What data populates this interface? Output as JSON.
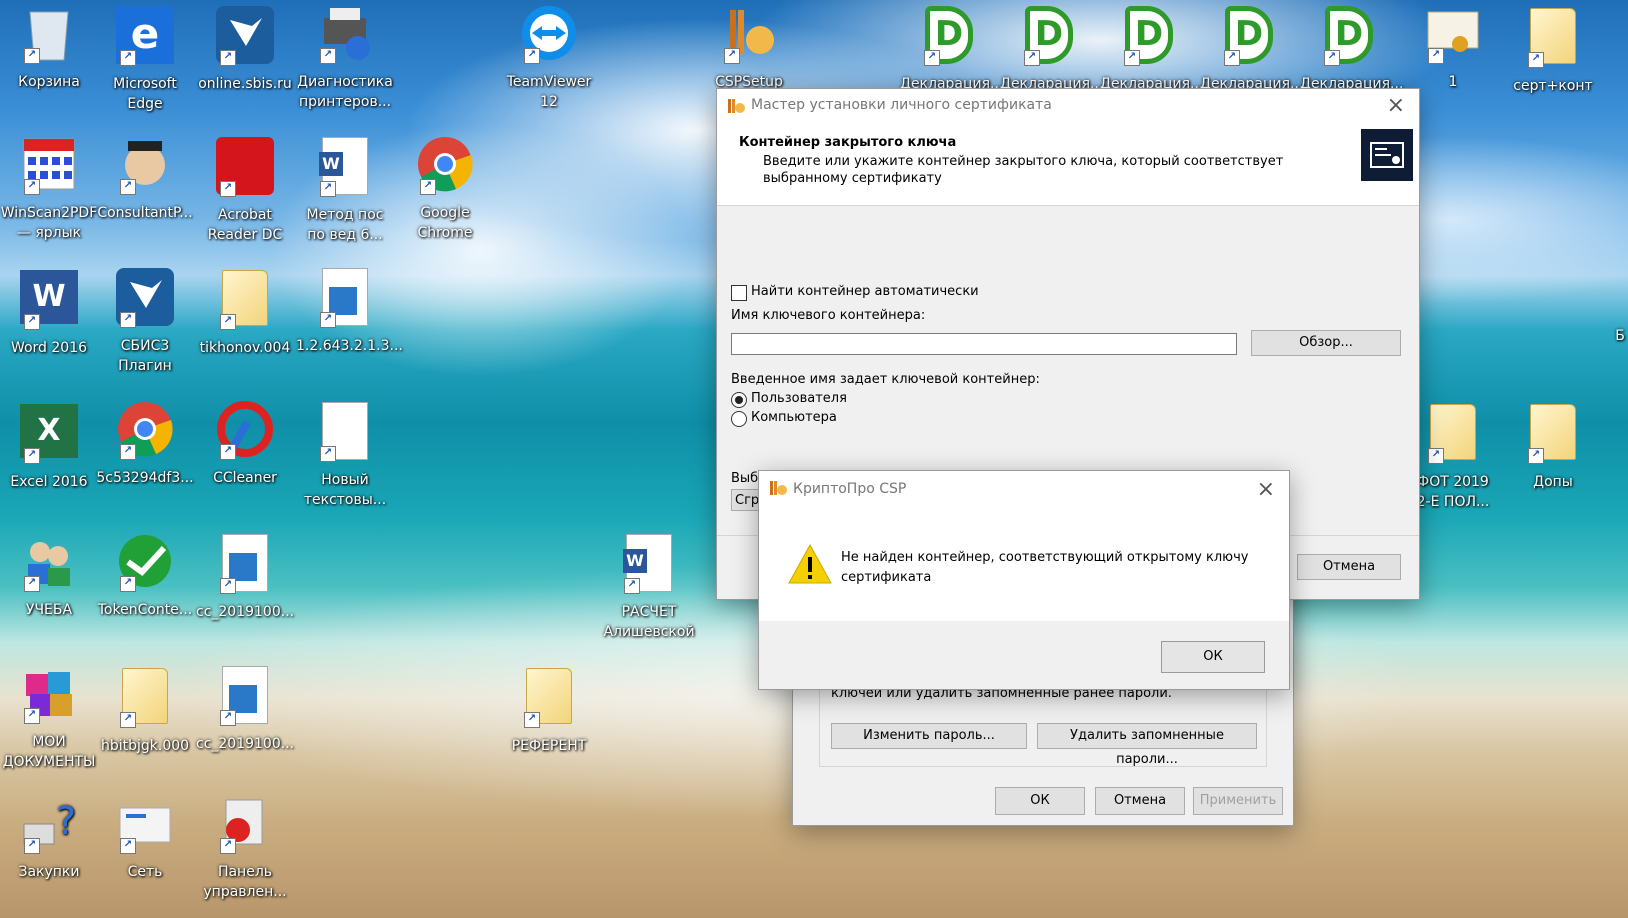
{
  "desktop_icons": [
    {
      "label": "Корзина",
      "icon": "recycle-bin-icon"
    },
    {
      "label": "Microsoft\nEdge",
      "icon": "edge-icon"
    },
    {
      "label": "online.sbis.ru",
      "icon": "sbis-bird-icon"
    },
    {
      "label": "Диагностика\nпринтеров...",
      "icon": "printer-icon"
    },
    {
      "label": "TeamViewer\n12",
      "icon": "teamviewer-icon"
    },
    {
      "label": "CSPSetup",
      "icon": "cspsetup-icon"
    },
    {
      "label": "Декларация...",
      "icon": "declaration-icon"
    },
    {
      "label": "Декларация...",
      "icon": "declaration-icon"
    },
    {
      "label": "Декларация...",
      "icon": "declaration-icon"
    },
    {
      "label": "Декларация...",
      "icon": "declaration-icon"
    },
    {
      "label": "Декларация...",
      "icon": "declaration-icon"
    },
    {
      "label": "1",
      "icon": "certificate-icon"
    },
    {
      "label": "серт+конт",
      "icon": "folder-icon"
    },
    {
      "label": "WinScan2PDF\n— ярлык",
      "icon": "winscan-icon"
    },
    {
      "label": "ConsultantP...",
      "icon": "consultant-icon"
    },
    {
      "label": "Acrobat\nReader DC",
      "icon": "acrobat-icon"
    },
    {
      "label": "Метод пос\nпо вед 6...",
      "icon": "word-doc-icon"
    },
    {
      "label": "Google\nChrome",
      "icon": "chrome-icon"
    },
    {
      "label": "Word 2016",
      "icon": "word-icon"
    },
    {
      "label": "СБИС3\nПлагин",
      "icon": "sbis-bird-icon"
    },
    {
      "label": "tikhonov.004",
      "icon": "folder-icon"
    },
    {
      "label": "1.2.643.2.1.3...",
      "icon": "cert-file-icon"
    },
    {
      "label": "Excel 2016",
      "icon": "excel-icon"
    },
    {
      "label": "5c53294df3...",
      "icon": "chrome-icon"
    },
    {
      "label": "CCleaner",
      "icon": "ccleaner-icon"
    },
    {
      "label": "Новый\nтекстовы...",
      "icon": "text-doc-icon"
    },
    {
      "label": "ФОТ 2019\n2-Е ПОЛ...",
      "icon": "folder-icon"
    },
    {
      "label": "Допы",
      "icon": "folder-icon"
    },
    {
      "label": "УЧЕБА",
      "icon": "users-icon"
    },
    {
      "label": "TokenConte...",
      "icon": "sberbank-icon"
    },
    {
      "label": "cc_2019100...",
      "icon": "cert-file-icon"
    },
    {
      "label": "РАСЧЕТ\nАлишевской",
      "icon": "word-doc-icon"
    },
    {
      "label": "МОИ\nДОКУМЕНТЫ",
      "icon": "documents-icon"
    },
    {
      "label": "hbitbjgk.000",
      "icon": "folder-icon"
    },
    {
      "label": "cc_2019100...",
      "icon": "cert-file-icon"
    },
    {
      "label": "РЕФЕРЕНТ",
      "icon": "folder-icon"
    },
    {
      "label": "Закупки",
      "icon": "help-icon"
    },
    {
      "label": "Сеть",
      "icon": "network-icon"
    },
    {
      "label": "Панель\nуправлен...",
      "icon": "control-panel-icon"
    }
  ],
  "edge_fragment": "Б",
  "wizard": {
    "title": "Мастер установки личного сертификата",
    "heading": "Контейнер закрытого ключа",
    "subheading": "Введите или укажите контейнер закрытого ключа, который соответствует\nвыбранному сертификату",
    "auto_find_label": "Найти контейнер автоматически",
    "auto_find_checked": false,
    "container_name_label": "Имя ключевого контейнера:",
    "container_name_value": "",
    "browse_button": "Обзор...",
    "scope_label": "Введенное имя задает ключевой контейнер:",
    "scope_user": "Пользователя",
    "scope_computer": "Компьютера",
    "scope_selected": "user",
    "partial_label": "Выб",
    "partial_field": "Сгр",
    "cancel_button": "Отмена"
  },
  "properties_dialog": {
    "hint_text": "ключей или удалить запомненные ранее пароли.",
    "change_password_button": "Изменить пароль...",
    "delete_passwords_button": "Удалить запомненные пароли...",
    "ok_button": "ОК",
    "cancel_button": "Отмена",
    "apply_button": "Применить"
  },
  "error_dialog": {
    "title": "КриптоПро CSP",
    "message": "Не найден контейнер, соответствующий открытому ключу\nсертификата",
    "ok_button": "ОК"
  },
  "colors": {
    "declaration_green": "#2d9a2a",
    "warning_yellow": "#f5d000"
  }
}
